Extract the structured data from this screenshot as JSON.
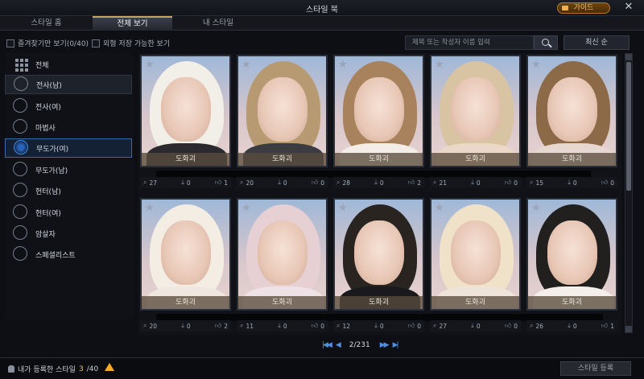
{
  "window": {
    "title": "스타일 북",
    "guide_label": "가이드",
    "close_label": "✕"
  },
  "tabs": [
    {
      "label": "스타일 홈"
    },
    {
      "label": "전체 보기"
    },
    {
      "label": "내 스타일"
    }
  ],
  "filters": {
    "favorites_label": "즐겨찾기만 보기(0/40)",
    "savable_label": "외형 저장 가능한 보기",
    "search_placeholder": "제목 또는 작성자 이름 입력",
    "sort_label": "최신 순"
  },
  "sidebar": {
    "items": [
      {
        "label": "전체"
      },
      {
        "label": "전사(남)"
      },
      {
        "label": "전사(여)"
      },
      {
        "label": "마법사"
      },
      {
        "label": "무도가(여)"
      },
      {
        "label": "무도가(남)"
      },
      {
        "label": "헌터(남)"
      },
      {
        "label": "헌터(여)"
      },
      {
        "label": "암살자"
      },
      {
        "label": "스페셜리스트"
      }
    ]
  },
  "cards": [
    {
      "caption": "도화괴",
      "views": "27",
      "downloads": "0",
      "likes": "1"
    },
    {
      "caption": "도화괴",
      "views": "20",
      "downloads": "0",
      "likes": "0"
    },
    {
      "caption": "도화괴",
      "views": "28",
      "downloads": "0",
      "likes": "2"
    },
    {
      "caption": "도화괴",
      "views": "21",
      "downloads": "0",
      "likes": "0"
    },
    {
      "caption": "도화괴",
      "views": "15",
      "downloads": "0",
      "likes": "0"
    },
    {
      "caption": "도화괴",
      "views": "20",
      "downloads": "0",
      "likes": "2"
    },
    {
      "caption": "도화괴",
      "views": "11",
      "downloads": "0",
      "likes": "0"
    },
    {
      "caption": "도화괴",
      "views": "12",
      "downloads": "0",
      "likes": "0"
    },
    {
      "caption": "도화괴",
      "views": "27",
      "downloads": "0",
      "likes": "0"
    },
    {
      "caption": "도화괴",
      "views": "26",
      "downloads": "0",
      "likes": "1"
    }
  ],
  "pager": {
    "page_text": "2/231"
  },
  "footer": {
    "registered_prefix": "내가 등록한 스타일",
    "registered_count": "3",
    "registered_total": "/40",
    "register_button": "스타일 등록"
  },
  "colors": {
    "accent_gold": "#c7a45a",
    "selected_blue": "#3a6aa5",
    "warning": "#f0b020"
  }
}
